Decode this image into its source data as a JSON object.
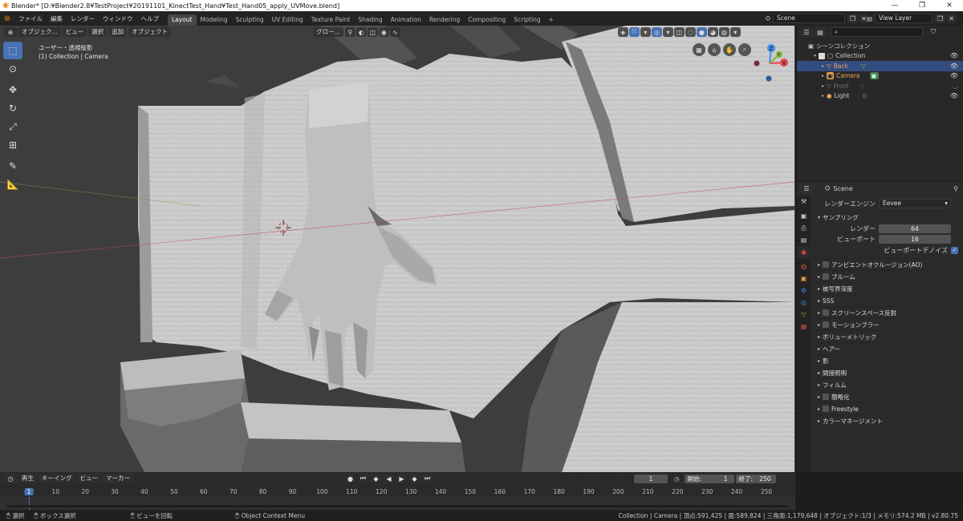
{
  "window": {
    "title": "Blender* [D:¥Blender2.8¥TestProject¥20191101_KinectTest_Hand¥Test_Hand05_apply_UVMove.blend]",
    "minimize": "—",
    "maximize": "❐",
    "close": "✕"
  },
  "menu": [
    "ファイル",
    "編集",
    "レンダー",
    "ウィンドウ",
    "ヘルプ"
  ],
  "workspaces": [
    "Layout",
    "Modeling",
    "Sculpting",
    "UV Editing",
    "Texture Paint",
    "Shading",
    "Animation",
    "Rendering",
    "Compositing",
    "Scripting"
  ],
  "workspace_add": "+",
  "scene_field": "Scene",
  "view_layer_field": "View Layer",
  "viewport": {
    "mode": "オブジェク...",
    "view_menu": "ビュー",
    "select_menu": "選択",
    "add_menu": "追加",
    "object_menu": "オブジェクト",
    "transform_orientation": "グロー...",
    "view_name": "ユーザー・透視投影",
    "collection_info": "(1) Collection | Camera",
    "gizmo_x": "X",
    "gizmo_y": "Y",
    "gizmo_z": "Z"
  },
  "outliner": {
    "root": "シーンコレクション",
    "collection": "Collection",
    "items": [
      {
        "name": "Back",
        "selected": true,
        "hidden": false
      },
      {
        "name": "Camera",
        "selected": false,
        "active": true,
        "hidden": false
      },
      {
        "name": "Front",
        "selected": false,
        "hidden": true
      },
      {
        "name": "Light",
        "selected": false,
        "hidden": false
      }
    ]
  },
  "properties": {
    "context": "Scene",
    "render_engine_label": "レンダーエンジン",
    "render_engine_value": "Eevee",
    "sampling": {
      "title": "サンプリング",
      "render_label": "レンダー",
      "render_value": "64",
      "viewport_label": "ビューポート",
      "viewport_value": "16",
      "denoise_label": "ビューポートデノイズ"
    },
    "sections": [
      {
        "label": "アンビエントオクルージョン(AO)",
        "checkbox": true
      },
      {
        "label": "ブルーム",
        "checkbox": true
      },
      {
        "label": "被写界深度",
        "checkbox": false
      },
      {
        "label": "SSS",
        "checkbox": false
      },
      {
        "label": "スクリーンスペース反射",
        "checkbox": true
      },
      {
        "label": "モーションブラー",
        "checkbox": true
      },
      {
        "label": "ボリューメトリック",
        "checkbox": false
      },
      {
        "label": "ヘアー",
        "checkbox": false
      },
      {
        "label": "影",
        "checkbox": false
      },
      {
        "label": "間接照明",
        "checkbox": false
      },
      {
        "label": "フィルム",
        "checkbox": false
      },
      {
        "label": "簡略化",
        "checkbox": true
      },
      {
        "label": "Freestyle",
        "checkbox": true
      },
      {
        "label": "カラーマネージメント",
        "checkbox": false
      }
    ]
  },
  "timeline": {
    "playback": "再生",
    "keying": "キーイング",
    "view": "ビュー",
    "marker": "マーカー",
    "current_frame": "1",
    "start_label": "開始:",
    "start_value": "1",
    "end_label": "終了:",
    "end_value": "250",
    "ticks": [
      "1",
      "10",
      "20",
      "30",
      "40",
      "50",
      "60",
      "70",
      "80",
      "90",
      "100",
      "110",
      "120",
      "130",
      "140",
      "150",
      "160",
      "170",
      "180",
      "190",
      "200",
      "210",
      "220",
      "230",
      "240",
      "250"
    ]
  },
  "statusbar": {
    "select": "選択",
    "box_select": "ボックス選択",
    "rotate_view": "ビューを回転",
    "context_menu": "Object Context Menu",
    "stats": "Collection | Camera | 頂点:591,425 | 面:589,824 | 三角面:1,179,648 | オブジェクト:1/3 | メモリ:574.2 MB | v2.80.75"
  },
  "colors": {
    "accent": "#4772b3",
    "x_axis": "#e8454f",
    "y_axis": "#7fba3f",
    "z_axis": "#3d8ee8",
    "mesh": "#c9c9c9"
  }
}
